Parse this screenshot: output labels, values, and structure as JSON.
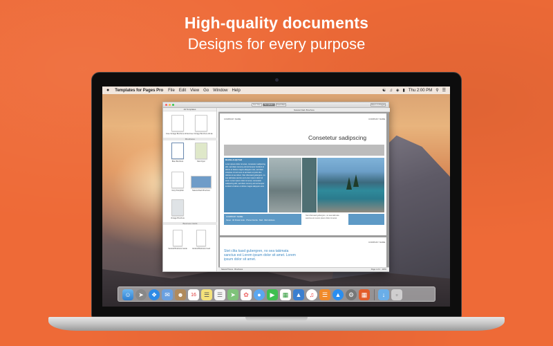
{
  "headline": "High-quality documents",
  "subheadline": "Designs for every purpose",
  "menubar": {
    "app_name": "Templates for Pages Pro",
    "items": [
      "File",
      "Edit",
      "View",
      "Go",
      "Window",
      "Help"
    ],
    "clock": "Thu 2:00 PM"
  },
  "window": {
    "segments": [
      "For You",
      "Templates",
      "Favorites"
    ],
    "action_button": "Open in Pages",
    "doc_title": "Natural Dark Brochure",
    "sidebar": {
      "header": "All Templates",
      "sections": [
        "Brochures",
        "Business Cards"
      ],
      "thumb_labels": [
        "Free Vintage Brochure A5 Ex",
        "Free Vintage Brochure A5 Ex",
        "Blue Brochure",
        "Park Flyer",
        "Grey Pamphlet",
        "Natural Dark Brochure",
        "Vintage Brochure",
        "Vertical Business Cards",
        "Vertical Business Card"
      ]
    },
    "page1": {
      "company_left": "COMPANY NAME",
      "company_right": "COMPANY NAME",
      "heading": "Consetetur sadipscing",
      "col_title": "MAGNA ALIQUYAM",
      "col_text": "Lorem ipsum dolor sit amet, consetetur sadipscing elitr, sed diam nonumy eirmod tempor invidunt ut labore et dolore magna aliquyam erat, sed diam voluptua. At vero eos et accusam et justo duo dolores et ea rebum. Stet clita kasd gubergren, no sea takimata sanctus est Lorem ipsum dolor sit amet. Lorem ipsum dolor sit amet, consetetur sadipscing elitr, sed diam nonumy eirmod tempor invidunt ut labore et dolore magna aliquyam erat.",
      "caption_title": "COMPANY NAME",
      "caption_text": "Street · 00 Postal Code · Phone Numbe · Mail · Web Address",
      "side_text": "Stet clita kasd gubergren, no sea takimata sanctus est Lorem ipsum dolor sit amet."
    },
    "page2": {
      "company_right": "COMPANY NAME",
      "blue_text": "Stet clita kasd gubergren, no sea takimata sanctus est Lorem ipsum dolor sit amet. Lorem ipsum dolor sit amet."
    },
    "status": {
      "left": "Natural Theme · Brochures",
      "right": "Page 1 of 2 · 100%"
    }
  },
  "dock": {
    "icons": [
      "finder-icon",
      "launchpad-icon",
      "safari-icon",
      "mail-icon",
      "contacts-icon",
      "calendar-icon",
      "notes-icon",
      "reminders-icon",
      "maps-icon",
      "photos-icon",
      "messages-icon",
      "facetime-icon",
      "numbers-icon",
      "keynote-icon",
      "music-icon",
      "books-icon",
      "app-store-icon",
      "system-preferences-icon",
      "templates-icon",
      "downloads-icon",
      "trash-icon"
    ],
    "calendar_day": "16"
  }
}
